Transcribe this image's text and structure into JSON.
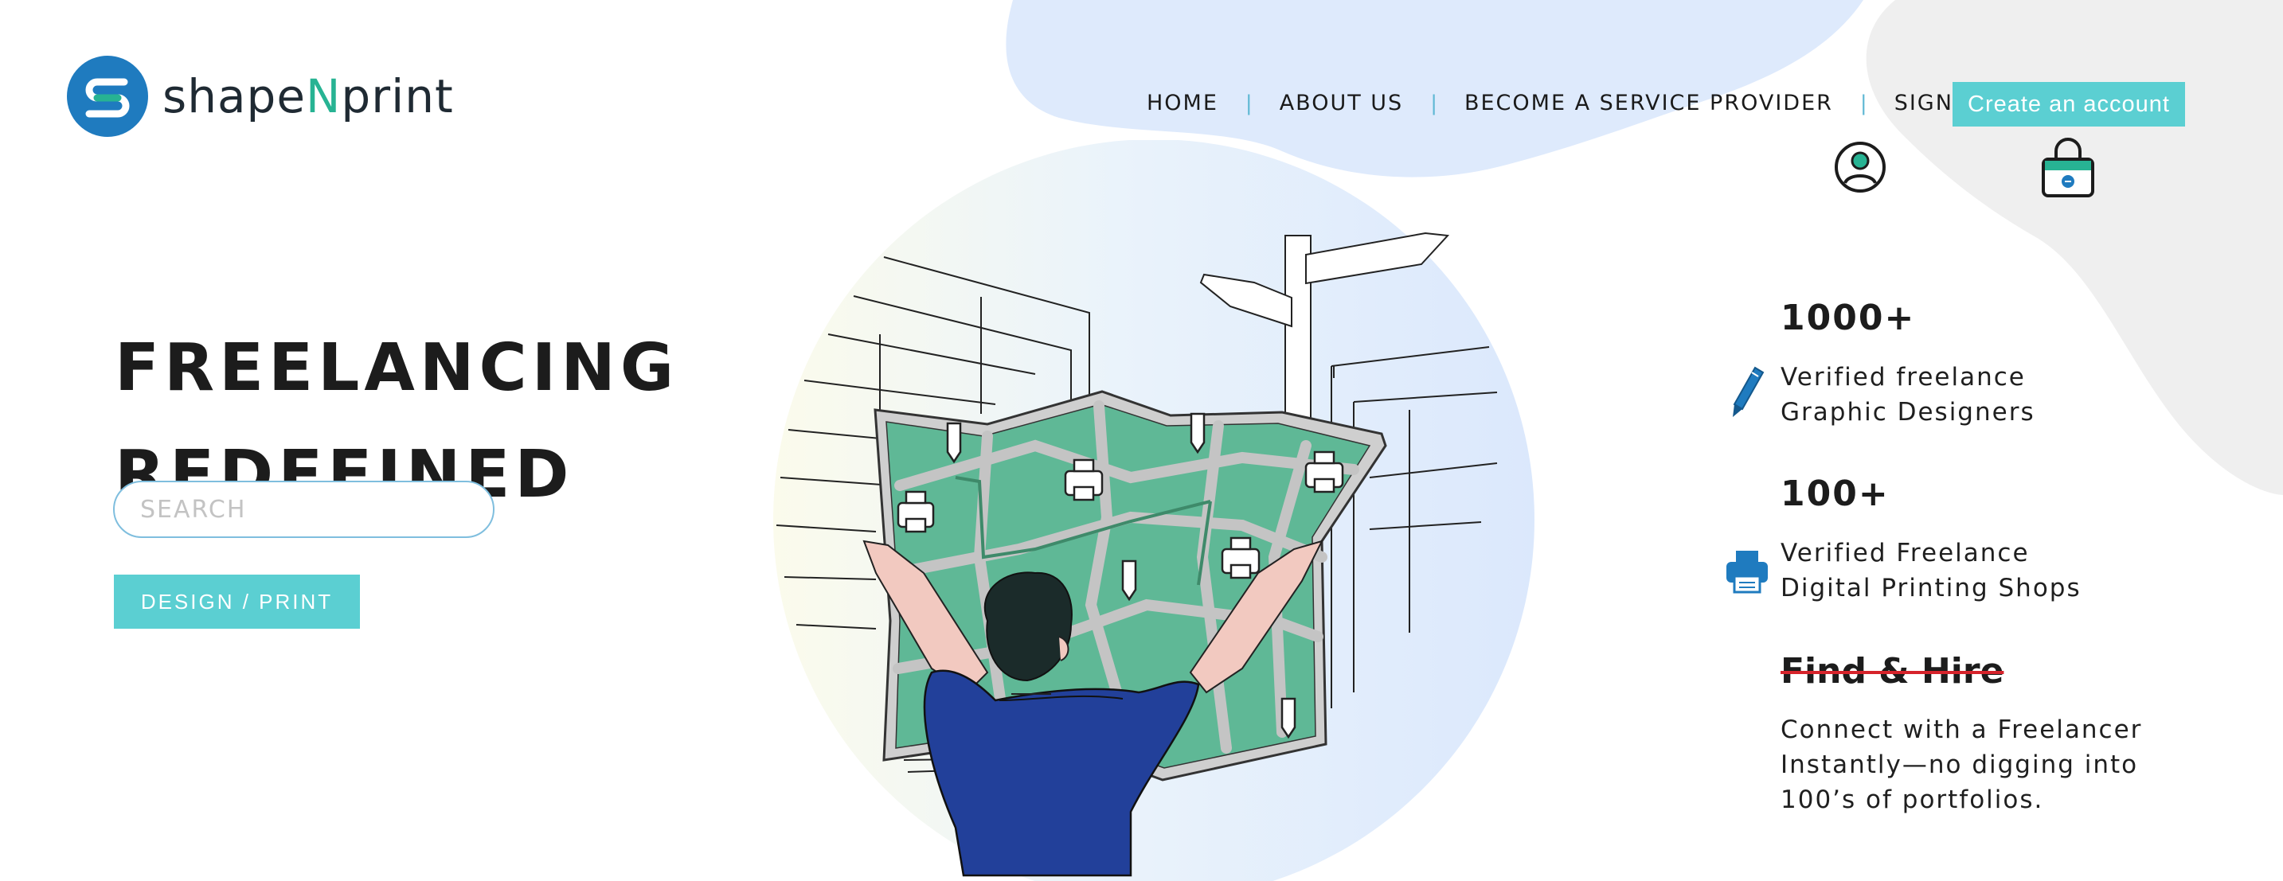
{
  "logo": {
    "text_prefix": "shape",
    "text_n": "N",
    "text_suffix": "print"
  },
  "nav": {
    "items": [
      {
        "label": "HOME"
      },
      {
        "label": "ABOUT US"
      },
      {
        "label": "BECOME A SERVICE PROVIDER"
      },
      {
        "label": "SIGN IN"
      }
    ],
    "separator": "|",
    "cta_label": "Create an account"
  },
  "hero": {
    "title_line1": "FREELANCING",
    "title_line2": "REDEFINED",
    "search_placeholder": "SEARCH",
    "button_label": "DESIGN / PRINT"
  },
  "stats": [
    {
      "number": "1000+",
      "line1": "Verified freelance",
      "line2": "Graphic Designers",
      "icon": "pencil-icon"
    },
    {
      "number": "100+",
      "line1": "Verified Freelance",
      "line2": "Digital Printing Shops",
      "icon": "printer-icon"
    }
  ],
  "find_hire": {
    "title": "Find & Hire",
    "line1": "Connect with a Freelancer",
    "line2": "Instantly—no digging into",
    "line3": "100’s of portfolios."
  },
  "colors": {
    "accent": "#5bcfd2",
    "logo_blue": "#1f7bbf",
    "logo_green": "#27b393",
    "map_green": "#5fb896",
    "shirt_blue": "#22409a",
    "strike_red": "#d6232b",
    "blob_blue": "#deeafc",
    "blob_gray": "#efefef"
  }
}
